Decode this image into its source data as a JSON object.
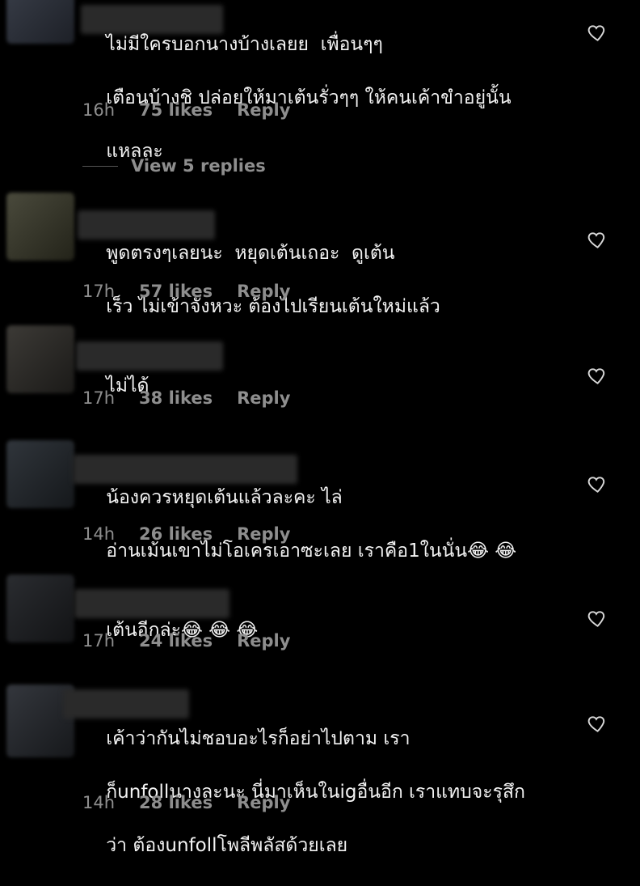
{
  "comments": [
    {
      "lines": [
        "ไม่มีใครบอกนางบ้างเลยย  เพื่อนๆๆ",
        "เตือนบ้างชิ ปล่อยให้มาเต้นรั่วๆๆ ให้คนเค้าขำอยู่นั้น",
        "แหลละ"
      ],
      "time": "16h",
      "likes": "75 likes",
      "reply": "Reply"
    },
    {
      "lines": [
        "พูดตรงๆเลยนะ  หยุดเต้นเถอะ  ดูเต้น",
        "เร็ว ไม่เข้าจังหวะ ต้องไปเรียนเต้นใหม่แล้ว"
      ],
      "time": "17h",
      "likes": "57 likes",
      "reply": "Reply"
    },
    {
      "lines": [
        "ไม่ได้"
      ],
      "time": "17h",
      "likes": "38 likes",
      "reply": "Reply"
    },
    {
      "lines": [
        "น้องควรหยุดเต้นแล้วละคะ ไล่",
        "อ่านเม้นเขาไม่โอเครเอาซะเลย เราคือ1ในนั่น😂 😂"
      ],
      "time": "14h",
      "likes": "26 likes",
      "reply": "Reply"
    },
    {
      "lines": [
        "เต้นอีกล่ะ😂 😂 😂"
      ],
      "time": "17h",
      "likes": "24 likes",
      "reply": "Reply"
    },
    {
      "lines": [
        "เค้าว่ากันไม่ชอบอะไรก็อย่าไปตาม เรา",
        "ก็unfollนางละนะ นี่มาเห็นในigอื่นอีก เราแทบจะรุสึก",
        "ว่า ต้องunfollโพลีพลัสด้วยเลย"
      ],
      "time": "14h",
      "likes": "28 likes",
      "reply": "Reply"
    }
  ],
  "view_replies": "View 5 replies",
  "icons": {
    "like": "heart-outline-icon"
  },
  "colors": {
    "background": "#000000",
    "text": "#f2f2f2",
    "meta": "#8e8e8e"
  }
}
